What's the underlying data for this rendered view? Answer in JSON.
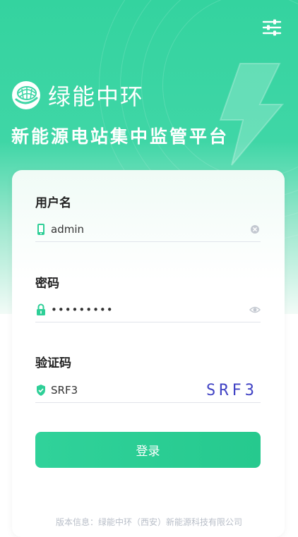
{
  "brand": {
    "name": "绿能中环",
    "platform_title": "新能源电站集中监管平台"
  },
  "form": {
    "username": {
      "label": "用户名",
      "value": "admin"
    },
    "password": {
      "label": "密码",
      "value": "•••••••••"
    },
    "captcha": {
      "label": "验证码",
      "value": "SRF3",
      "image_text": "SRF3"
    },
    "login_label": "登录"
  },
  "footer": {
    "version_info": "版本信息：绿能中环（西安）新能源科技有限公司"
  },
  "colors": {
    "primary": "#2ecf97",
    "captcha": "#4042c4",
    "icon": "#2ecf97"
  }
}
